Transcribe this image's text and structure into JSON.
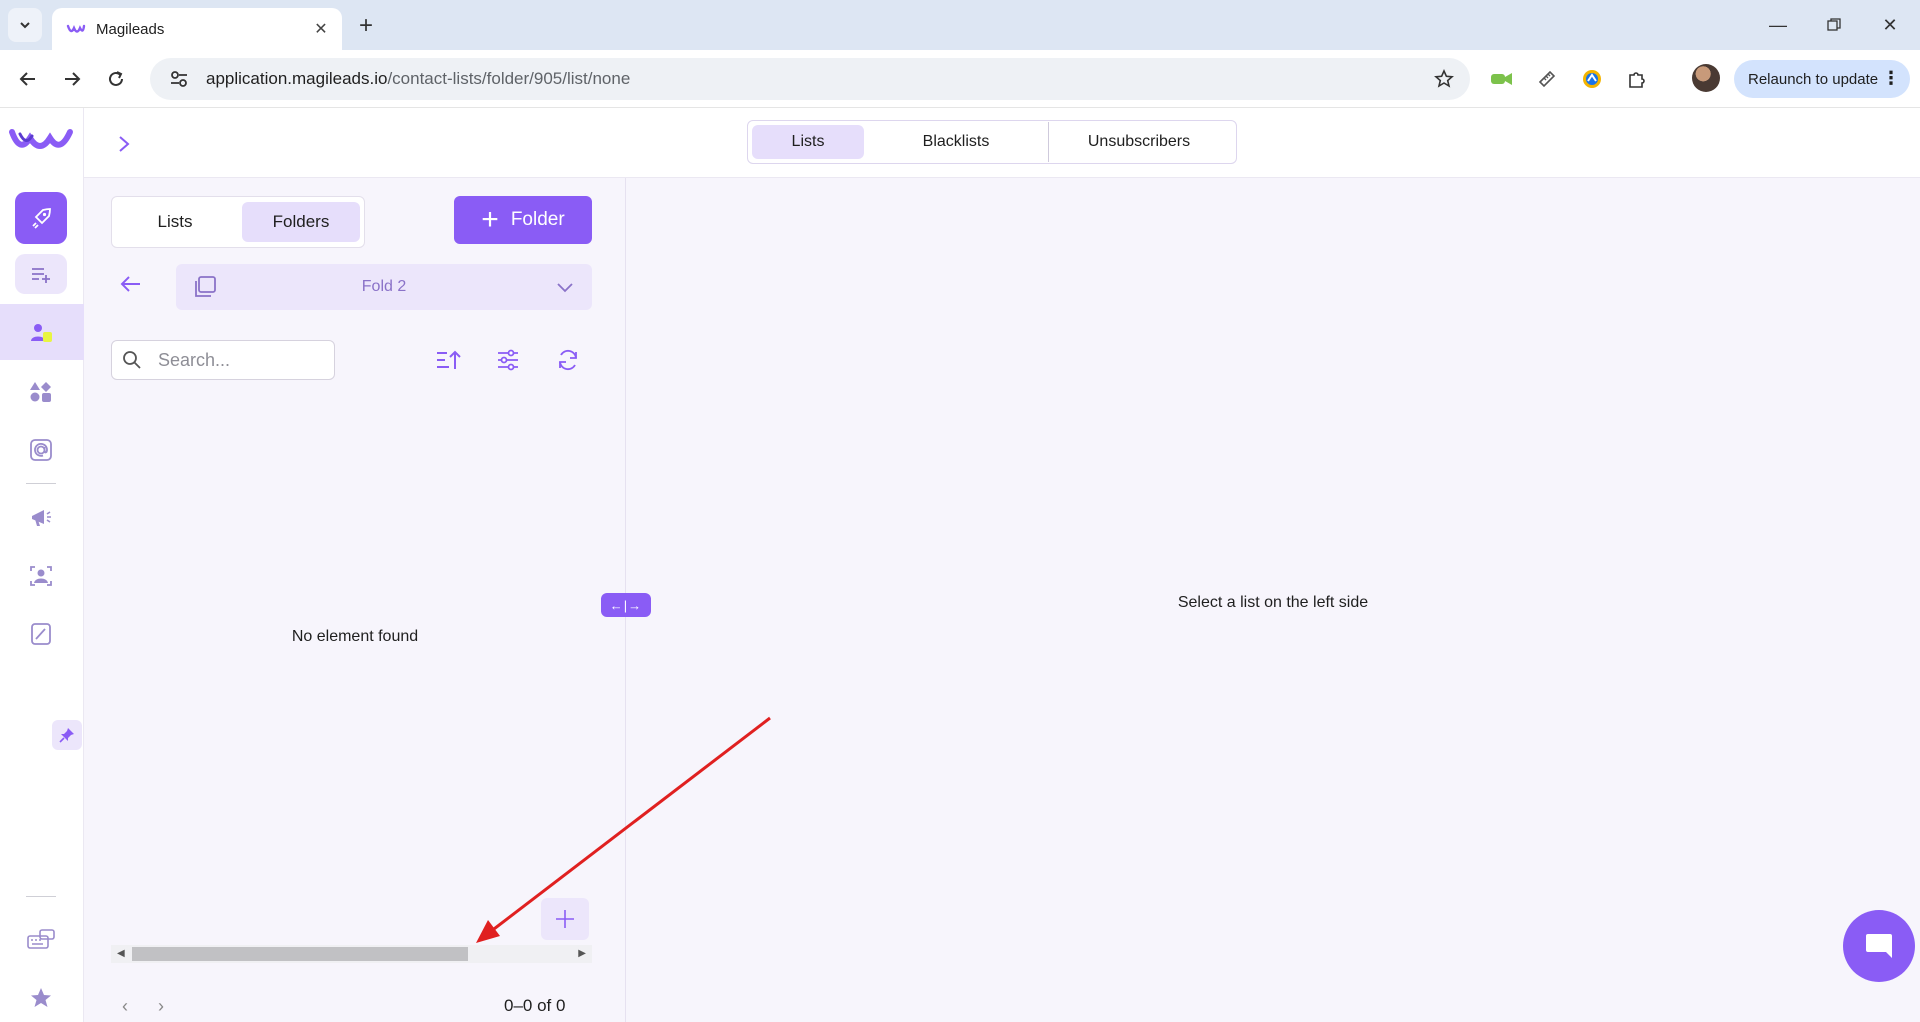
{
  "browser": {
    "tab_title": "Magileads",
    "url_domain": "application.magileads.io",
    "url_path": "/contact-lists/folder/905/list/none",
    "relaunch_label": "Relaunch to update"
  },
  "app": {
    "top_tabs": [
      {
        "label": "Lists",
        "active": true
      },
      {
        "label": "Blacklists",
        "active": false
      },
      {
        "label": "Unsubscribers",
        "active": false
      }
    ],
    "left_toggle": [
      {
        "label": "Lists",
        "active": false
      },
      {
        "label": "Folders",
        "active": true
      }
    ],
    "add_folder_label": "Folder",
    "current_folder": "Fold 2",
    "search_placeholder": "Search...",
    "empty_message": "No element found",
    "pagination": "0–0 of 0",
    "right_message": "Select a list on the left side",
    "resizer_label": "←|→",
    "accent_color": "#8a5cf5",
    "annotation_color": "#e02020"
  }
}
